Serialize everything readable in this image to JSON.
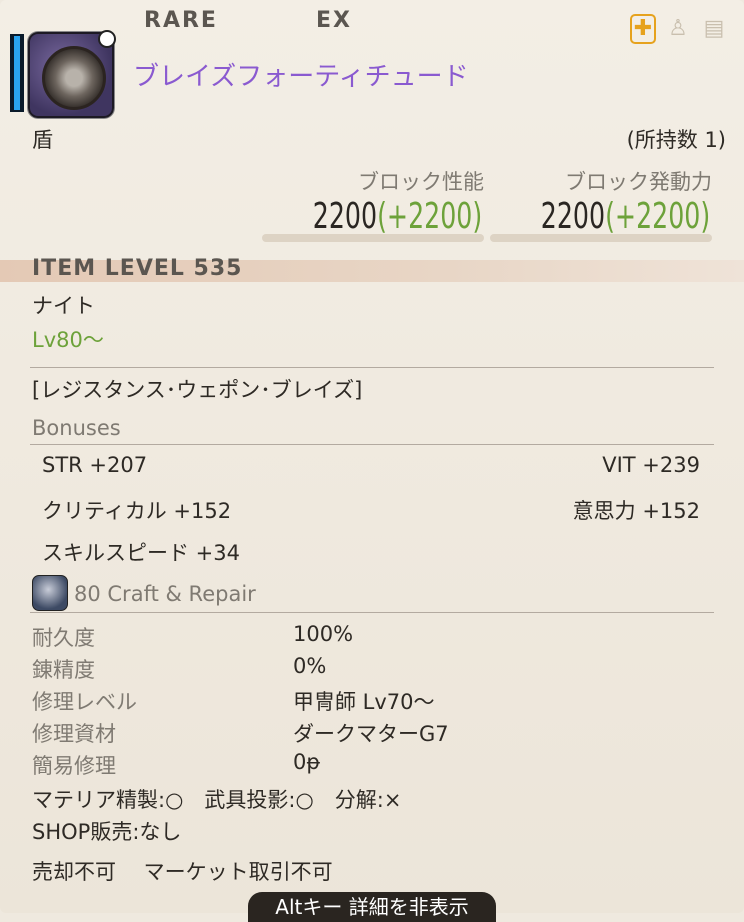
{
  "header": {
    "rarity": "RARE",
    "ex": "EX",
    "item_name": "ブレイズフォーティチュード",
    "category": "盾",
    "owned": "(所持数 1)"
  },
  "stats": {
    "block_label": "ブロック性能",
    "block_value": "2200",
    "block_bonus": "(+2200)",
    "block_rate_label": "ブロック発動力",
    "block_rate_value": "2200",
    "block_rate_bonus": "(+2200)"
  },
  "item_level": "ITEM LEVEL 535",
  "job": "ナイト",
  "level_req": "Lv80～",
  "series": "[レジスタンス･ウェポン･ブレイズ]",
  "bonuses": {
    "title": "Bonuses",
    "str": "STR +207",
    "vit": "VIT +239",
    "crit": "クリティカル +152",
    "det": "意思力 +152",
    "sks": "スキルスピード +34"
  },
  "craft": {
    "title": "80 Craft & Repair",
    "rows": [
      {
        "label": "耐久度",
        "value": "100%"
      },
      {
        "label": "錬精度",
        "value": "0%"
      },
      {
        "label": "修理レベル",
        "value": "甲冑師 Lv70～"
      },
      {
        "label": "修理資材",
        "value": "ダークマターG7"
      },
      {
        "label": "簡易修理",
        "value": "0ᵽ"
      }
    ],
    "materia": "マテリア精製:○　武具投影:○　分解:×",
    "shop": "SHOP販売:なし",
    "sell": "売却不可　 マーケット取引不可"
  },
  "footer": "Altキー 詳細を非表示",
  "colors": {
    "name": "#8a5ad0",
    "green": "#6da23a",
    "bg": "#efe9df"
  },
  "icons": [
    "shield-item-icon",
    "armory-icon",
    "glamour-icon",
    "retainer-icon",
    "craft-repair-icon"
  ]
}
